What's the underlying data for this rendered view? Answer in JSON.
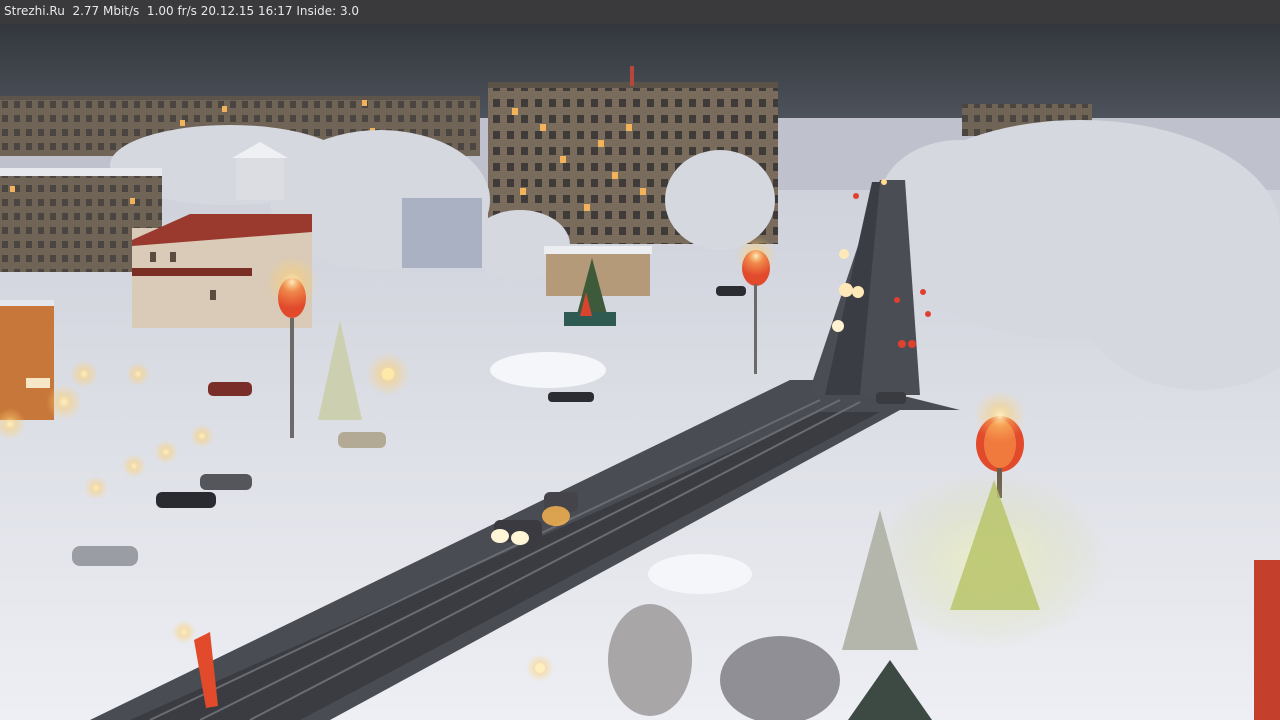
{
  "camera": {
    "overlay_text": "Strezhi.Ru  2.77 Mbit/s  1.00 fr/s 20.12.15 16:17 Inside: 3.0"
  },
  "scene": {
    "description_icon": "webcam-frame",
    "colors": {
      "sky": "#3c4046",
      "snow": "#e9eaf0",
      "road": "#3d3f45",
      "building": "#8a7a68",
      "window_lit": "#f2b35a",
      "street_light": "#ffe9a8",
      "decoration_red": "#e24a2c"
    }
  }
}
